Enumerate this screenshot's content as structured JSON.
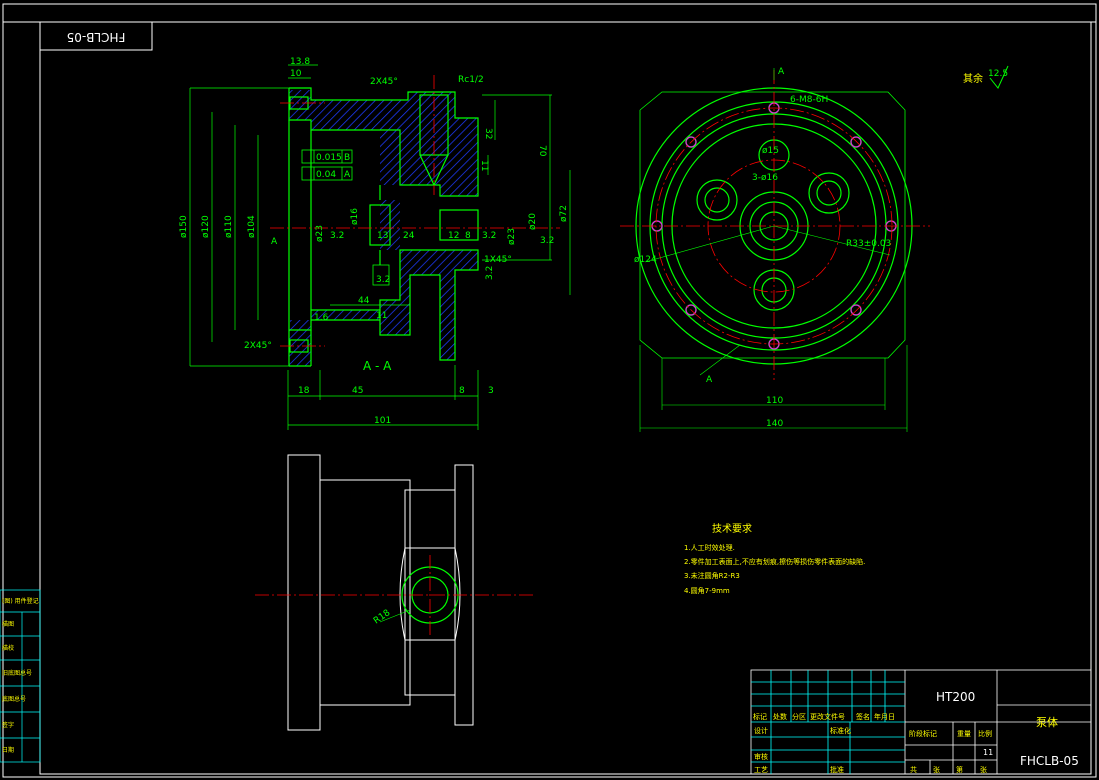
{
  "drawing": {
    "code_mirrored": "FHCLB-05",
    "section_label": "A - A",
    "section_marker": "A",
    "roughness_note": "其余",
    "roughness_value": "12.5"
  },
  "dims_section": {
    "d13_8": "13.8",
    "d10": "10",
    "d2x45_top": "2X45°",
    "rc": "Rc1/2",
    "d32": "32",
    "d70": "70",
    "d11a": "11",
    "d150": "ø150",
    "d120": "ø120",
    "d110": "ø110",
    "d104": "ø104",
    "tol1": "0.015",
    "tol1_ref": "B",
    "tol2": "0.04",
    "tol2_ref": "A",
    "d16": "ø16",
    "d23": "ø23",
    "r3_2a": "3.2",
    "d13": "13",
    "d24": "24",
    "d12": "12",
    "d8": "8",
    "r3_2b": "3.2",
    "d23b": "ø23",
    "d20": "ø20",
    "d72": "ø72",
    "r3_2c": "3.2",
    "c1x45": "1X45°",
    "r3_2d": "3.2",
    "d44": "44",
    "r1_6": "1.6",
    "d11b": "11",
    "c2x45b": "2X45°",
    "d18": "18",
    "d45": "45",
    "d8b": "8",
    "d3": "3",
    "d101": "101",
    "d3_2e": "3.2"
  },
  "dims_front": {
    "holes": "6-M8-6H",
    "d15": "ø15",
    "holes2": "3-ø16",
    "d124": "ø124",
    "r33": "R33±0.03",
    "d110": "110",
    "d140": "140",
    "sec_a_top": "A",
    "sec_a_bot": "A"
  },
  "dims_bottom": {
    "r18": "R18"
  },
  "tech": {
    "title": "技术要求",
    "items": [
      "1.人工时效处理.",
      "2.零件加工表面上,不应有划痕,擦伤等损伤零件表面的缺陷.",
      "3.未注圆角R2-R3",
      "4.圆角7-9mm"
    ]
  },
  "title_block": {
    "material": "HT200",
    "part_name": "泵体",
    "code": "FHCLB-05",
    "scale_val": "11",
    "row_labels": [
      "标记",
      "处数",
      "分区",
      "更改文件号",
      "签名",
      "年月日"
    ],
    "std_label": "标准化",
    "stage_label": "阶段标记",
    "weight_label": "重量",
    "scale_label": "比例",
    "design": "设计",
    "review": "审核",
    "process": "工艺",
    "approve": "批准",
    "sheets": [
      "共",
      "张",
      "第",
      "张"
    ]
  },
  "left_strip": [
    "(图) 用件登记",
    "描图",
    "描校",
    "旧底图总号",
    "底图总号",
    "签字",
    "日期"
  ],
  "colors": {
    "frame": "#ffffff",
    "outline": "#00ff00",
    "centerline": "#ff0000",
    "dimension": "#00ff00",
    "hatch": "#0000ff",
    "cyan": "#00ffff",
    "yellow": "#ffff00",
    "magenta": "#ff00ff"
  }
}
